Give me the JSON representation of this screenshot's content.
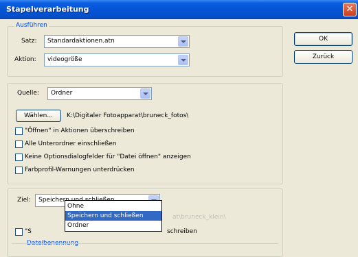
{
  "window": {
    "title": "Stapelverarbeitung",
    "close_glyph": "✕"
  },
  "ausfuehren": {
    "legend": "Ausführen",
    "satz_label": "Satz:",
    "satz_value": "Standardaktionen.atn",
    "aktion_label": "Aktion:",
    "aktion_value": "videogröße"
  },
  "buttons": {
    "ok": "OK",
    "back": "Zurück"
  },
  "quelle": {
    "label": "Quelle:",
    "value": "Ordner",
    "choose_button": "Wählen...",
    "path": "K:\\Digitaler Fotoapparat\\bruneck_fotos\\",
    "checkboxes": [
      {
        "label": "\"Öffnen\" in Aktionen überschreiben",
        "checked": false
      },
      {
        "label": "Alle Unterordner einschließen",
        "checked": false
      },
      {
        "label": "Keine Optionsdialogfelder für \"Datei öffnen\" anzeigen",
        "checked": false
      },
      {
        "label": "Farbprofil-Warnungen unterdrücken",
        "checked": false
      }
    ]
  },
  "ziel": {
    "label": "Ziel:",
    "value": "Speichern und schließen",
    "options": [
      "Ohne",
      "Speichern und schließen",
      "Ordner"
    ],
    "selected_index": 1,
    "behind_path_fragment": "at\\bruneck_klein\\",
    "behind_checkbox_tail": "schreiben",
    "behind_checkbox_prefix": "\"S",
    "dateibenennung_legend": "Dateibenennung"
  }
}
